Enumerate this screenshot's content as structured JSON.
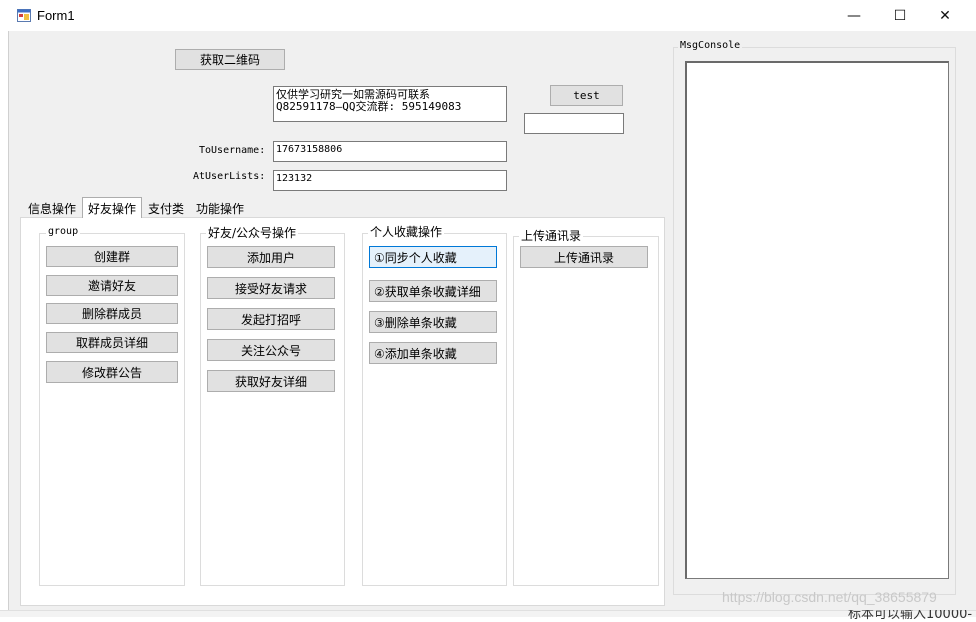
{
  "window": {
    "title": "Form1",
    "minimize": "—",
    "maximize": "☐",
    "close": "✕"
  },
  "top": {
    "qr_button": "获取二维码",
    "notice_line1": "仅供学习研究一如需源码可联系",
    "notice_line2": "Q82591178—QQ交流群: 595149083",
    "test_button": "test",
    "test_input": "",
    "to_username_label": "ToUsername:",
    "to_username_value": "17673158806",
    "at_user_label": "AtUserLists:",
    "at_user_value": "123132"
  },
  "tabs": [
    {
      "label": "信息操作",
      "active": false
    },
    {
      "label": "好友操作",
      "active": true
    },
    {
      "label": "支付类",
      "active": false
    },
    {
      "label": "功能操作",
      "active": false
    }
  ],
  "groups": {
    "group": {
      "title": "group",
      "buttons": [
        "创建群",
        "邀请好友",
        "删除群成员",
        "取群成员详细",
        "修改群公告"
      ]
    },
    "friend": {
      "title": "好友/公众号操作",
      "buttons": [
        "添加用户",
        "接受好友请求",
        "发起打招呼",
        "关注公众号",
        "获取好友详细"
      ]
    },
    "favorites": {
      "title": "个人收藏操作",
      "buttons": [
        "①同步个人收藏",
        "②获取单条收藏详细",
        "③删除单条收藏",
        "④添加单条收藏"
      ]
    },
    "contacts": {
      "title": "上传通讯录",
      "buttons": [
        "上传通讯录"
      ]
    }
  },
  "console": {
    "title": "MsgConsole",
    "content": ""
  },
  "watermark": "https://blog.csdn.net/qq_38655879",
  "background_text": "标本可以输入10000-"
}
